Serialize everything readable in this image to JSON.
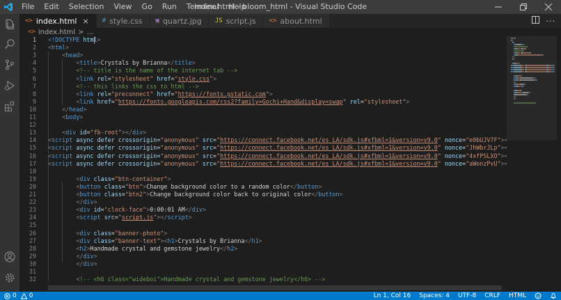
{
  "window": {
    "title": "index.html - bloom_html - Visual Studio Code"
  },
  "menu": [
    "File",
    "Edit",
    "Selection",
    "View",
    "Go",
    "Run",
    "Terminal",
    "Help"
  ],
  "tabs": [
    {
      "icon": "<>",
      "label": "index.html",
      "close": "×",
      "active": true,
      "color": "#e37933"
    },
    {
      "icon": "#",
      "label": "style.css",
      "active": false,
      "color": "#519aba"
    },
    {
      "icon": "▣",
      "label": "quartz.jpg",
      "active": false,
      "color": "#a074c4"
    },
    {
      "icon": "JS",
      "label": "script.js",
      "active": false,
      "color": "#cbcb41"
    },
    {
      "icon": "<>",
      "label": "about.html",
      "active": false,
      "color": "#e37933"
    }
  ],
  "breadcrumb": {
    "icon": "<>",
    "file": "index.html",
    "separator": ">",
    "more": "..."
  },
  "code_lines": [
    [
      [
        "t",
        "<"
      ],
      [
        "tg",
        "!DOCTYPE "
      ],
      [
        "at",
        "html"
      ],
      [
        "t",
        ">"
      ]
    ],
    [
      [
        "t",
        "<"
      ],
      [
        "tg",
        "html"
      ],
      [
        "t",
        ">"
      ]
    ],
    [
      [
        "tx",
        "    "
      ],
      [
        "t",
        "<"
      ],
      [
        "tg",
        "head"
      ],
      [
        "t",
        ">"
      ]
    ],
    [
      [
        "tx",
        "        "
      ],
      [
        "t",
        "<"
      ],
      [
        "tg",
        "title"
      ],
      [
        "t",
        ">"
      ],
      [
        "tx",
        "Crystals by Brianna"
      ],
      [
        "t",
        "</"
      ],
      [
        "tg",
        "title"
      ],
      [
        "t",
        ">"
      ]
    ],
    [
      [
        "tx",
        "        "
      ],
      [
        "cm",
        "<!-- title is the name of the internet tab -->"
      ]
    ],
    [
      [
        "tx",
        "        "
      ],
      [
        "t",
        "<"
      ],
      [
        "tg",
        "link "
      ],
      [
        "at",
        "rel"
      ],
      [
        "tx",
        "="
      ],
      [
        "st",
        "\"stylesheet\""
      ],
      [
        "tx",
        " "
      ],
      [
        "at",
        "href"
      ],
      [
        "tx",
        "="
      ],
      [
        "st",
        "\""
      ],
      [
        "stu",
        "style.css"
      ],
      [
        "st",
        "\""
      ],
      [
        "t",
        ">"
      ]
    ],
    [
      [
        "tx",
        "        "
      ],
      [
        "cm",
        "<!-- this links the css to html -->"
      ]
    ],
    [
      [
        "tx",
        "        "
      ],
      [
        "t",
        "<"
      ],
      [
        "tg",
        "link "
      ],
      [
        "at",
        "rel"
      ],
      [
        "tx",
        "="
      ],
      [
        "st",
        "\"preconnect\""
      ],
      [
        "tx",
        " "
      ],
      [
        "at",
        "href"
      ],
      [
        "tx",
        "="
      ],
      [
        "st",
        "\""
      ],
      [
        "stu",
        "https://fonts.gstatic.com"
      ],
      [
        "st",
        "\""
      ],
      [
        "t",
        ">"
      ]
    ],
    [
      [
        "tx",
        "        "
      ],
      [
        "t",
        "<"
      ],
      [
        "tg",
        "link "
      ],
      [
        "at",
        "href"
      ],
      [
        "tx",
        "="
      ],
      [
        "st",
        "\""
      ],
      [
        "stu",
        "https://fonts.googleapis.com/css2?family=Gochi+Hand&display=swap"
      ],
      [
        "st",
        "\""
      ],
      [
        "tx",
        " "
      ],
      [
        "at",
        "rel"
      ],
      [
        "tx",
        "="
      ],
      [
        "st",
        "\"stylesheet\""
      ],
      [
        "t",
        ">"
      ]
    ],
    [
      [
        "tx",
        "    "
      ],
      [
        "t",
        "</"
      ],
      [
        "tg",
        "head"
      ],
      [
        "t",
        ">"
      ]
    ],
    [
      [
        "tx",
        "    "
      ],
      [
        "t",
        "<"
      ],
      [
        "tg",
        "body"
      ],
      [
        "t",
        ">"
      ]
    ],
    [],
    [
      [
        "tx",
        "    "
      ],
      [
        "t",
        "<"
      ],
      [
        "tg",
        "div "
      ],
      [
        "at",
        "id"
      ],
      [
        "tx",
        "="
      ],
      [
        "st",
        "\"fb-root\""
      ],
      [
        "t",
        "></"
      ],
      [
        "tg",
        "div"
      ],
      [
        "t",
        ">"
      ]
    ],
    [
      [
        "t",
        "<"
      ],
      [
        "tg",
        "script "
      ],
      [
        "at",
        "async defer crossorigin"
      ],
      [
        "tx",
        "="
      ],
      [
        "st",
        "\"anonymous\""
      ],
      [
        "tx",
        " "
      ],
      [
        "at",
        "src"
      ],
      [
        "tx",
        "="
      ],
      [
        "st",
        "\""
      ],
      [
        "stu",
        "https://connect.facebook.net/es_LA/sdk.js#xfbml=1&version=v9.0"
      ],
      [
        "st",
        "\""
      ],
      [
        "tx",
        " "
      ],
      [
        "at",
        "nonce"
      ],
      [
        "tx",
        "="
      ],
      [
        "st",
        "\"e0bUJV7F\""
      ],
      [
        "t",
        "></"
      ],
      [
        "tg",
        "script"
      ],
      [
        "t",
        ">"
      ]
    ],
    [
      [
        "t",
        "<"
      ],
      [
        "tg",
        "script "
      ],
      [
        "at",
        "async defer crossorigin"
      ],
      [
        "tx",
        "="
      ],
      [
        "st",
        "\"anonymous\""
      ],
      [
        "tx",
        " "
      ],
      [
        "at",
        "src"
      ],
      [
        "tx",
        "="
      ],
      [
        "st",
        "\""
      ],
      [
        "stu",
        "https://connect.facebook.net/es_LA/sdk.js#xfbml=1&version=v9.0"
      ],
      [
        "st",
        "\""
      ],
      [
        "tx",
        " "
      ],
      [
        "at",
        "nonce"
      ],
      [
        "tx",
        "="
      ],
      [
        "st",
        "\"JhWbrJLp\""
      ],
      [
        "t",
        "></"
      ],
      [
        "tg",
        "script"
      ],
      [
        "t",
        ">"
      ]
    ],
    [
      [
        "t",
        "<"
      ],
      [
        "tg",
        "script "
      ],
      [
        "at",
        "async defer crossorigin"
      ],
      [
        "tx",
        "="
      ],
      [
        "st",
        "\"anonymous\""
      ],
      [
        "tx",
        " "
      ],
      [
        "at",
        "src"
      ],
      [
        "tx",
        "="
      ],
      [
        "st",
        "\""
      ],
      [
        "stu",
        "https://connect.facebook.net/es_LA/sdk.js#xfbml=1&version=v9.0"
      ],
      [
        "st",
        "\""
      ],
      [
        "tx",
        " "
      ],
      [
        "at",
        "nonce"
      ],
      [
        "tx",
        "="
      ],
      [
        "st",
        "\"4xfPSLXO\""
      ],
      [
        "t",
        "></"
      ],
      [
        "tg",
        "script"
      ],
      [
        "t",
        ">"
      ]
    ],
    [
      [
        "t",
        "<"
      ],
      [
        "tg",
        "script "
      ],
      [
        "at",
        "async defer crossorigin"
      ],
      [
        "tx",
        "="
      ],
      [
        "st",
        "\"anonymous\""
      ],
      [
        "tx",
        " "
      ],
      [
        "at",
        "src"
      ],
      [
        "tx",
        "="
      ],
      [
        "st",
        "\""
      ],
      [
        "stu",
        "https://connect.facebook.net/es_LA/sdk.js#xfbml=1&version=v9.0"
      ],
      [
        "st",
        "\""
      ],
      [
        "tx",
        " "
      ],
      [
        "at",
        "nonce"
      ],
      [
        "tx",
        "="
      ],
      [
        "st",
        "\"aWonzPvU\""
      ],
      [
        "t",
        "></"
      ],
      [
        "tg",
        "script"
      ],
      [
        "t",
        ">"
      ]
    ],
    [],
    [
      [
        "tx",
        "        "
      ],
      [
        "t",
        "<"
      ],
      [
        "tg",
        "div "
      ],
      [
        "at",
        "class"
      ],
      [
        "tx",
        "="
      ],
      [
        "st",
        "\"btn-container\""
      ],
      [
        "t",
        ">"
      ]
    ],
    [
      [
        "tx",
        "        "
      ],
      [
        "t",
        "<"
      ],
      [
        "tg",
        "button "
      ],
      [
        "at",
        "class"
      ],
      [
        "tx",
        "="
      ],
      [
        "st",
        "\"btn\""
      ],
      [
        "t",
        ">"
      ],
      [
        "tx",
        "Change background color to a random color"
      ],
      [
        "t",
        "</"
      ],
      [
        "tg",
        "button"
      ],
      [
        "t",
        ">"
      ]
    ],
    [
      [
        "tx",
        "        "
      ],
      [
        "t",
        "<"
      ],
      [
        "tg",
        "button "
      ],
      [
        "at",
        "class"
      ],
      [
        "tx",
        "="
      ],
      [
        "st",
        "\"btn2\""
      ],
      [
        "t",
        ">"
      ],
      [
        "tx",
        "Change background color back to original color"
      ],
      [
        "t",
        "</"
      ],
      [
        "tg",
        "button"
      ],
      [
        "t",
        ">"
      ]
    ],
    [
      [
        "tx",
        "        "
      ],
      [
        "t",
        "</"
      ],
      [
        "tg",
        "div"
      ],
      [
        "t",
        ">"
      ]
    ],
    [
      [
        "tx",
        "        "
      ],
      [
        "t",
        "<"
      ],
      [
        "tg",
        "div "
      ],
      [
        "at",
        "id"
      ],
      [
        "tx",
        "="
      ],
      [
        "st",
        "\"clock-face\""
      ],
      [
        "t",
        ">"
      ],
      [
        "tx",
        "0:00:01 AM"
      ],
      [
        "t",
        "</"
      ],
      [
        "tg",
        "div"
      ],
      [
        "t",
        ">"
      ]
    ],
    [
      [
        "tx",
        "        "
      ],
      [
        "t",
        "<"
      ],
      [
        "tg",
        "script "
      ],
      [
        "at",
        "src"
      ],
      [
        "tx",
        "="
      ],
      [
        "st",
        "\""
      ],
      [
        "stu",
        "script.js"
      ],
      [
        "st",
        "\""
      ],
      [
        "t",
        "></"
      ],
      [
        "tg",
        "script"
      ],
      [
        "t",
        ">"
      ]
    ],
    [],
    [
      [
        "tx",
        "        "
      ],
      [
        "t",
        "<"
      ],
      [
        "tg",
        "div "
      ],
      [
        "at",
        "class"
      ],
      [
        "tx",
        "="
      ],
      [
        "st",
        "\"banner-photo\""
      ],
      [
        "t",
        ">"
      ]
    ],
    [
      [
        "tx",
        "        "
      ],
      [
        "t",
        "<"
      ],
      [
        "tg",
        "div "
      ],
      [
        "at",
        "class"
      ],
      [
        "tx",
        "="
      ],
      [
        "st",
        "\"banner-text\""
      ],
      [
        "t",
        "><"
      ],
      [
        "tg",
        "h1"
      ],
      [
        "t",
        ">"
      ],
      [
        "tx",
        "Crystals by Brianna"
      ],
      [
        "t",
        "</"
      ],
      [
        "tg",
        "h1"
      ],
      [
        "t",
        ">"
      ]
    ],
    [
      [
        "tx",
        "        "
      ],
      [
        "t",
        "<"
      ],
      [
        "tg",
        "h2"
      ],
      [
        "t",
        ">"
      ],
      [
        "tx",
        "Handmade crystal and gemstone jewelry"
      ],
      [
        "t",
        "</"
      ],
      [
        "tg",
        "h2"
      ],
      [
        "t",
        ">"
      ]
    ],
    [
      [
        "tx",
        "        "
      ],
      [
        "t",
        "</"
      ],
      [
        "tg",
        "div"
      ],
      [
        "t",
        ">"
      ]
    ],
    [
      [
        "tx",
        "        "
      ],
      [
        "t",
        "</"
      ],
      [
        "tg",
        "div"
      ],
      [
        "t",
        ">"
      ]
    ],
    [],
    [
      [
        "tx",
        "        "
      ],
      [
        "cm",
        "<!-- <h6 class=\"wideboi\">Handmade crystal and gemstone jewelry</h6> -->"
      ]
    ]
  ],
  "status": {
    "errors": "0",
    "warnings": "0",
    "position": "Ln 1, Col 16",
    "spaces": "Spaces: 4",
    "encoding": "UTF-8",
    "eol": "CRLF",
    "language": "HTML"
  },
  "colors": {
    "accent": "#007acc",
    "tag": "#569cd6",
    "attribute": "#9cdcfe",
    "string": "#ce9178",
    "comment": "#6a9955"
  }
}
